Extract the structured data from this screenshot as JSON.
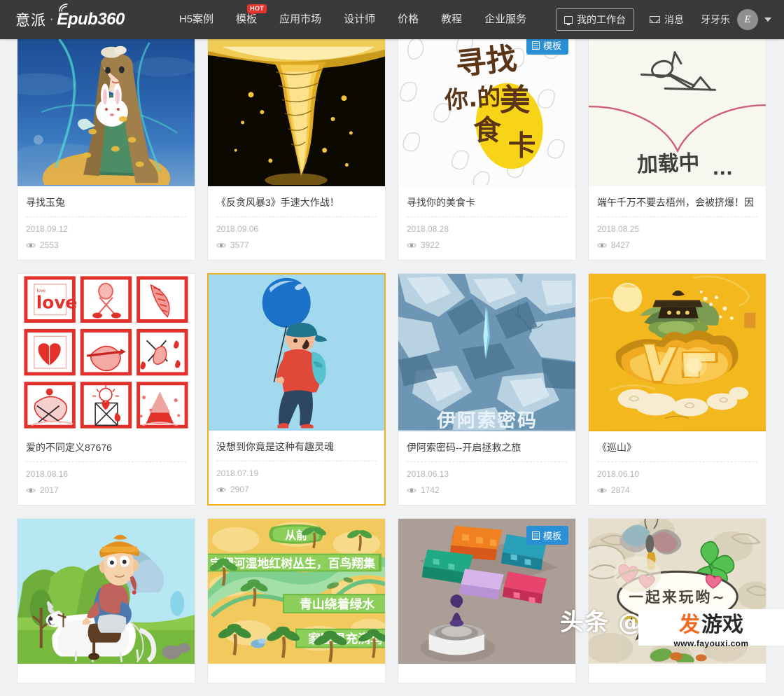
{
  "header": {
    "logo_cn": "意派",
    "logo_sep": "·",
    "logo_en": "Epub360",
    "nav": [
      {
        "label": "H5案例",
        "badge": null
      },
      {
        "label": "模板",
        "badge": "HOT"
      },
      {
        "label": "应用市场",
        "badge": null
      },
      {
        "label": "设计师",
        "badge": null
      },
      {
        "label": "价格",
        "badge": null
      },
      {
        "label": "教程",
        "badge": null
      },
      {
        "label": "企业服务",
        "badge": null
      }
    ],
    "workbench_label": "我的工作台",
    "messages_label": "消息",
    "username": "牙牙乐",
    "avatar_initial": "E",
    "accent_blue": "#2b8fd6",
    "accent_hot": "#e8322c",
    "bar_bg": "#3a3a3c"
  },
  "badges": {
    "template_label": "模板"
  },
  "cards": [
    {
      "title": "寻找玉兔",
      "date": "2018.09.12",
      "views": "2553",
      "badge": null,
      "hovered": false,
      "art": "t1"
    },
    {
      "title": "《反贪风暴3》手速大作战！",
      "date": "2018.09.06",
      "views": "3577",
      "badge": null,
      "hovered": false,
      "art": "t2"
    },
    {
      "title": "寻找你的美食卡",
      "date": "2018.08.28",
      "views": "3922",
      "badge": "模板",
      "hovered": false,
      "art": "t3"
    },
    {
      "title": "端午千万不要去梧州，会被挤爆！因",
      "date": "2018.08.25",
      "views": "8427",
      "badge": null,
      "hovered": false,
      "art": "t4"
    },
    {
      "title": "爱的不同定义87676",
      "date": "2018.08.16",
      "views": "2017",
      "badge": null,
      "hovered": false,
      "art": "t5"
    },
    {
      "title": "没想到你竟是这种有趣灵魂",
      "date": "2018.07.19",
      "views": "2907",
      "badge": null,
      "hovered": true,
      "art": "t6"
    },
    {
      "title": "伊阿索密码--开启拯救之旅",
      "date": "2018.06.13",
      "views": "1742",
      "badge": null,
      "hovered": false,
      "art": "t7"
    },
    {
      "title": "《巡山》",
      "date": "2018.06.10",
      "views": "2874",
      "badge": null,
      "hovered": false,
      "art": "t8"
    },
    {
      "title": "",
      "date": "",
      "views": "",
      "badge": null,
      "hovered": false,
      "art": "t9"
    },
    {
      "title": "",
      "date": "",
      "views": "",
      "badge": null,
      "hovered": false,
      "art": "t10"
    },
    {
      "title": "",
      "date": "",
      "views": "",
      "badge": "模板",
      "hovered": false,
      "art": "t11"
    },
    {
      "title": "",
      "date": "",
      "views": "",
      "badge": null,
      "hovered": false,
      "art": "t12"
    }
  ],
  "thumbnail_text": {
    "card3_line1": "寻找",
    "card3_line2": "你.的美",
    "card3_line3": "食卡",
    "card4_loading": "加载中...",
    "card5_love": "love",
    "card7_title": "伊阿索密码",
    "card10_tag1": "从前",
    "card10_tag2": "宝翎河湿地红树丛生，百鸟翔集",
    "card10_tag3": "青山绕着绿水",
    "card10_tag4": "家园里充满鸟",
    "card12_bubble": "一起来玩哟~"
  },
  "watermark": {
    "toutiao": "头条 @",
    "logo_fa": "发",
    "logo_youxi": "游戏",
    "url": "www.fayouxi.com"
  }
}
